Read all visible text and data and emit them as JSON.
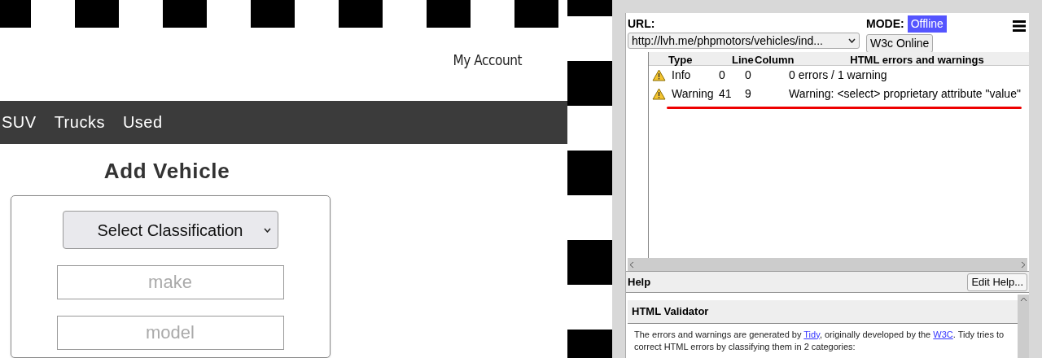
{
  "site": {
    "account_link": "My Account",
    "nav": [
      "SUV",
      "Trucks",
      "Used"
    ],
    "heading": "Add Vehicle",
    "form": {
      "select": "Select Classification",
      "fields": [
        {
          "placeholder": "make"
        },
        {
          "placeholder": "model"
        }
      ]
    }
  },
  "validator": {
    "url_label": "URL:",
    "url": "http://lvh.me/phpmotors/vehicles/ind...",
    "mode_label": "MODE:",
    "modes": [
      {
        "label": "Offline",
        "selected": true
      },
      {
        "label": "W3c Online",
        "selected": false
      }
    ],
    "table": {
      "columns": [
        "Type",
        "Line",
        "Column",
        "HTML errors and warnings"
      ],
      "rows": [
        {
          "type": "Info",
          "line": "0",
          "column": "0",
          "message": "0 errors / 1 warning"
        },
        {
          "type": "Warning",
          "line": "41",
          "column": "9",
          "message": "Warning: <select> proprietary attribute \"value\""
        }
      ]
    },
    "help": {
      "title": "Help",
      "edit_button": "Edit Help...",
      "heading": "HTML Validator",
      "text": [
        "The errors and warnings are generated by ",
        "Tidy",
        ", originally developed by the ",
        "W3C",
        ". Tidy tries to correct HTML errors by classifying them in 2 categories:"
      ]
    }
  }
}
